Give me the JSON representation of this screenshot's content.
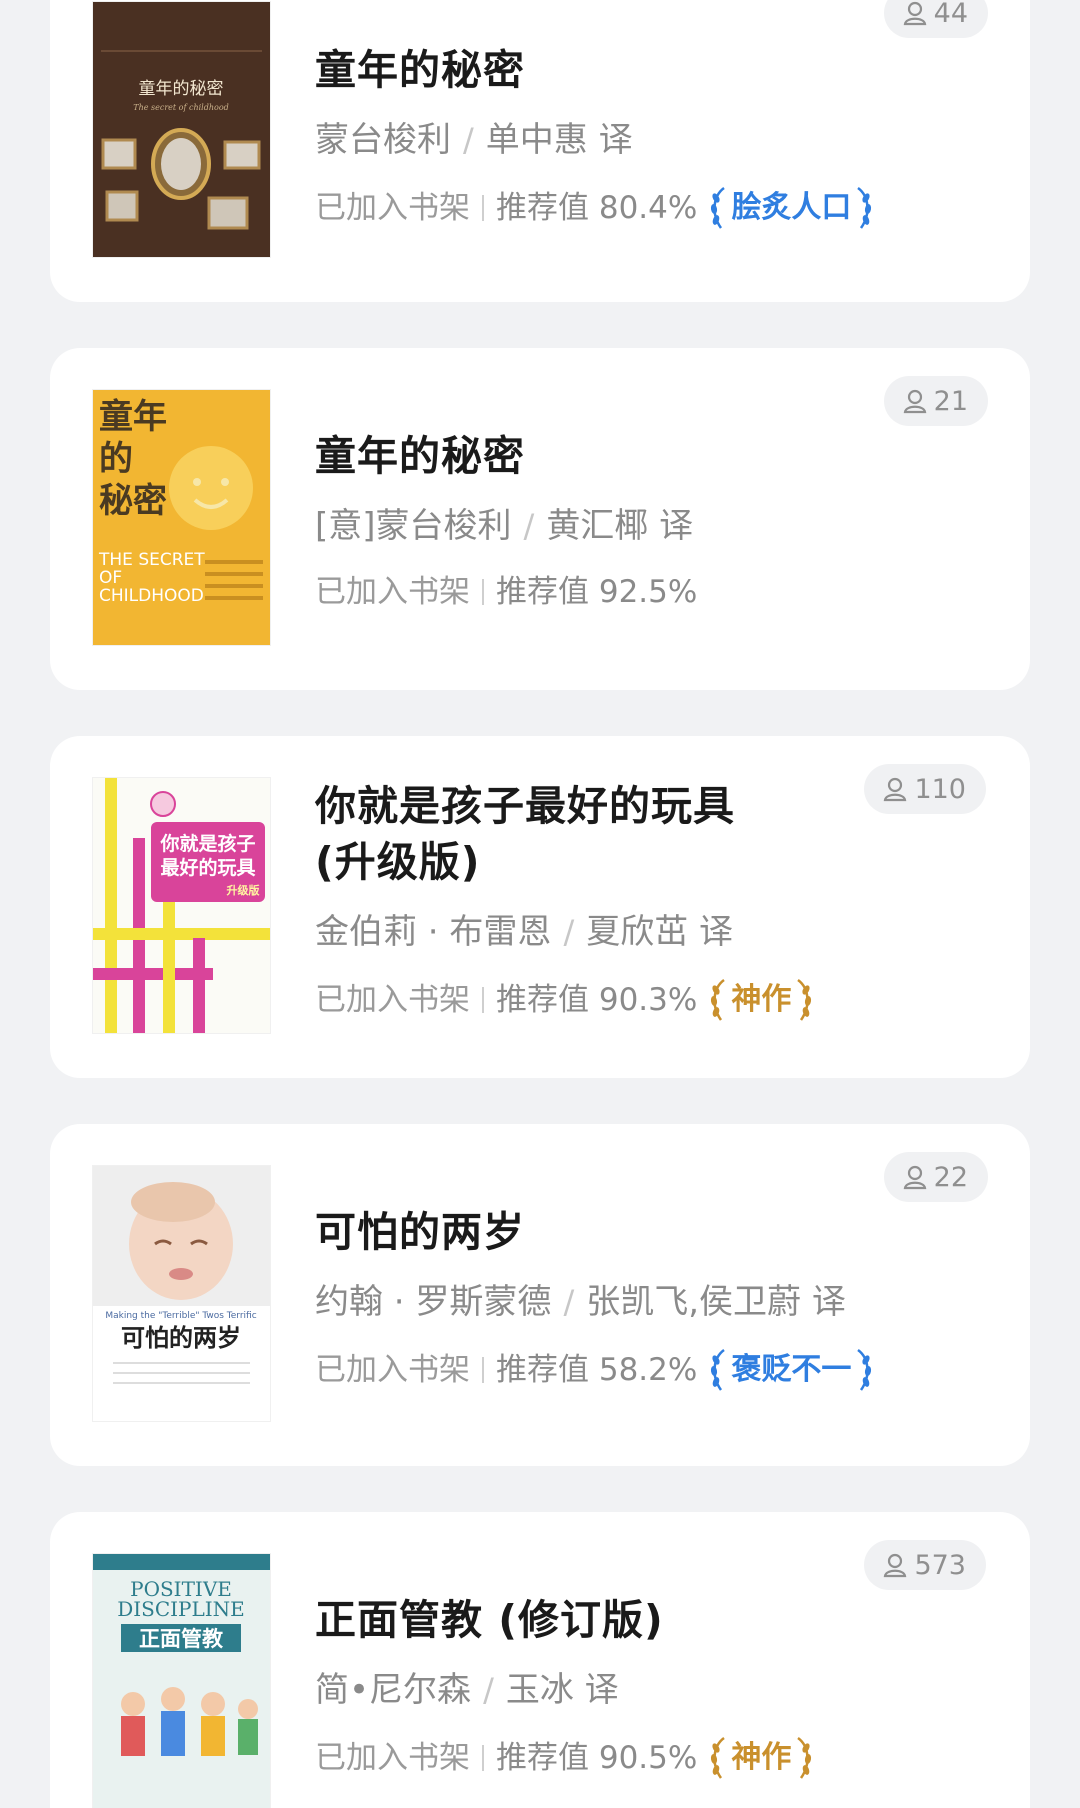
{
  "books": [
    {
      "title": "童年的秘密",
      "author": "蒙台梭利",
      "translator": "单中惠 译",
      "shelf": "已加入书架",
      "rec_label": "推荐值 80.4%",
      "badge": "脍炙人口",
      "badge_color": "#2f7ee0",
      "readers": "44",
      "cover_texts": [
        "童年的秘密",
        "The secret of childhood"
      ]
    },
    {
      "title": "童年的秘密",
      "author": "[意]蒙台梭利",
      "translator": "黄汇椰 译",
      "shelf": "已加入书架",
      "rec_label": "推荐值 92.5%",
      "badge": "",
      "readers": "21",
      "cover_texts": [
        "童年",
        "的",
        "秘密",
        "THE SECRET",
        "OF",
        "CHILDHOOD"
      ]
    },
    {
      "title": "你就是孩子最好的玩具",
      "title_line2": "(升级版)",
      "author": "金伯莉 · 布雷恩",
      "translator": "夏欣茁 译",
      "shelf": "已加入书架",
      "rec_label": "推荐值 90.3%",
      "badge": "神作",
      "badge_color": "#c9902d",
      "readers": "110",
      "cover_texts": [
        "你就是孩子",
        "最好的玩具",
        "升级版"
      ]
    },
    {
      "title": "可怕的两岁",
      "author": "约翰 · 罗斯蒙德",
      "translator": "张凯飞,侯卫蔚 译",
      "shelf": "已加入书架",
      "rec_label": "推荐值 58.2%",
      "badge": "褒贬不一",
      "badge_color": "#2f7ee0",
      "readers": "22",
      "cover_texts": [
        "Making the \"Terrible\" Twos Terrific",
        "可怕的两岁"
      ]
    },
    {
      "title": "正面管教 (修订版)",
      "author": "简•尼尔森",
      "translator": "玉冰 译",
      "shelf": "已加入书架",
      "rec_label": "推荐值 90.5%",
      "badge": "神作",
      "badge_color": "#c9902d",
      "readers": "573",
      "cover_texts": [
        "POSITIVE",
        "DISCIPLINE",
        "正面管教"
      ]
    }
  ],
  "icons": {
    "readers": "person-icon",
    "badge_decor": "laurel-icon"
  }
}
